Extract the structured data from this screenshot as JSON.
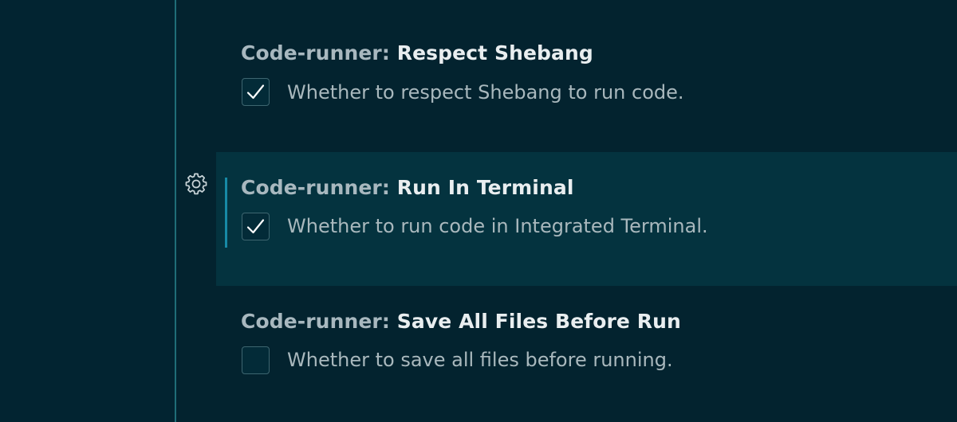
{
  "settings": [
    {
      "category": "Code-runner: ",
      "name": "Respect Shebang",
      "description": "Whether to respect Shebang to run code.",
      "checked": true,
      "focused": false
    },
    {
      "category": "Code-runner: ",
      "name": "Run In Terminal",
      "description": "Whether to run code in Integrated Terminal.",
      "checked": true,
      "focused": true
    },
    {
      "category": "Code-runner: ",
      "name": "Save All Files Before Run",
      "description": "Whether to save all files before running.",
      "checked": false,
      "focused": false
    }
  ],
  "icons": {
    "manage": "gear-icon",
    "check": "checkmark-icon"
  },
  "colors": {
    "background": "#03232f",
    "focused_row": "#04333f",
    "focus_indicator": "#178aa6",
    "divider": "#1f6e78"
  }
}
